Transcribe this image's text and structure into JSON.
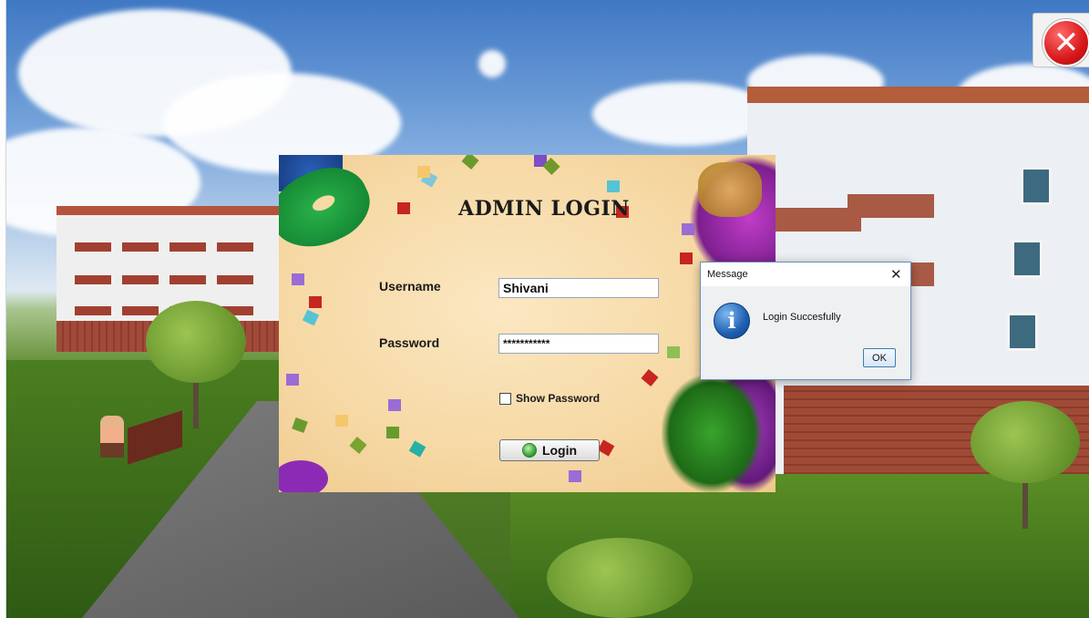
{
  "window": {
    "close_icon": "close-circle-icon",
    "close_symbol": "✕"
  },
  "login": {
    "title": "ADMIN LOGIN",
    "username_label": "Username",
    "username_value": "Shivani",
    "password_label": "Password",
    "password_value": "***********",
    "show_password_label": "Show Password",
    "show_password_checked": false,
    "login_label": "Login",
    "login_icon": "green-orb-icon"
  },
  "dialog": {
    "title": "Message",
    "close_symbol": "✕",
    "info_symbol": "i",
    "message": "Login Succesfully",
    "ok_label": "OK"
  },
  "colors": {
    "panel_bg": "#f6d9a5",
    "close_red": "#d8181a",
    "info_blue": "#1f5fb2"
  }
}
